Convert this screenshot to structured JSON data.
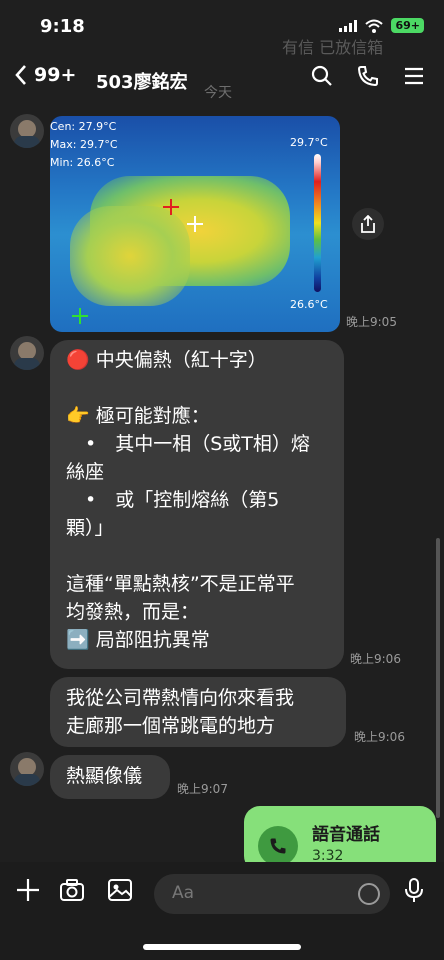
{
  "status_bar": {
    "time": "9:18",
    "battery": "69+"
  },
  "header": {
    "back_count": "99+",
    "title": "503廖銘宏"
  },
  "ghost_text": {
    "top_bubble": "有信 已放信箱",
    "today": "今天"
  },
  "thermal_image": {
    "cen": "Cen: 27.9°C",
    "max": "Max: 29.7°C",
    "min": "Min: 26.6°C",
    "scale_max": "29.7°C",
    "scale_min": "26.6°C"
  },
  "messages": [
    {
      "time": "晚上9:05"
    },
    {
      "lines": [
        "🔴 中央偏熱（紅十字）",
        "",
        "👉 極可能對應：",
        "　•　其中一相（S或T相）熔",
        "絲座",
        "　•　或「控制熔絲（第5",
        "顆）」",
        "",
        "這種“單點熱核”不是正常平",
        "均發熱，而是：",
        "➡️ 局部阻抗異常"
      ],
      "time": "晚上9:06"
    },
    {
      "lines": [
        "我從公司帶熱情向你來看我",
        "走廊那一個常跳電的地方"
      ],
      "time": "晚上9:06"
    },
    {
      "lines": [
        "熱顯像儀"
      ],
      "time": "晚上9:07"
    }
  ],
  "voice_call": {
    "title": "語音通話",
    "duration": "3:32"
  },
  "composer": {
    "placeholder": "Aa"
  },
  "icons": {
    "back": "chevron-left-icon",
    "search": "search-icon",
    "call": "phone-icon",
    "menu": "menu-icon",
    "share": "share-icon",
    "add": "plus-icon",
    "camera": "camera-icon",
    "image": "image-icon",
    "emoji": "emoji-icon",
    "mic": "microphone-icon"
  }
}
